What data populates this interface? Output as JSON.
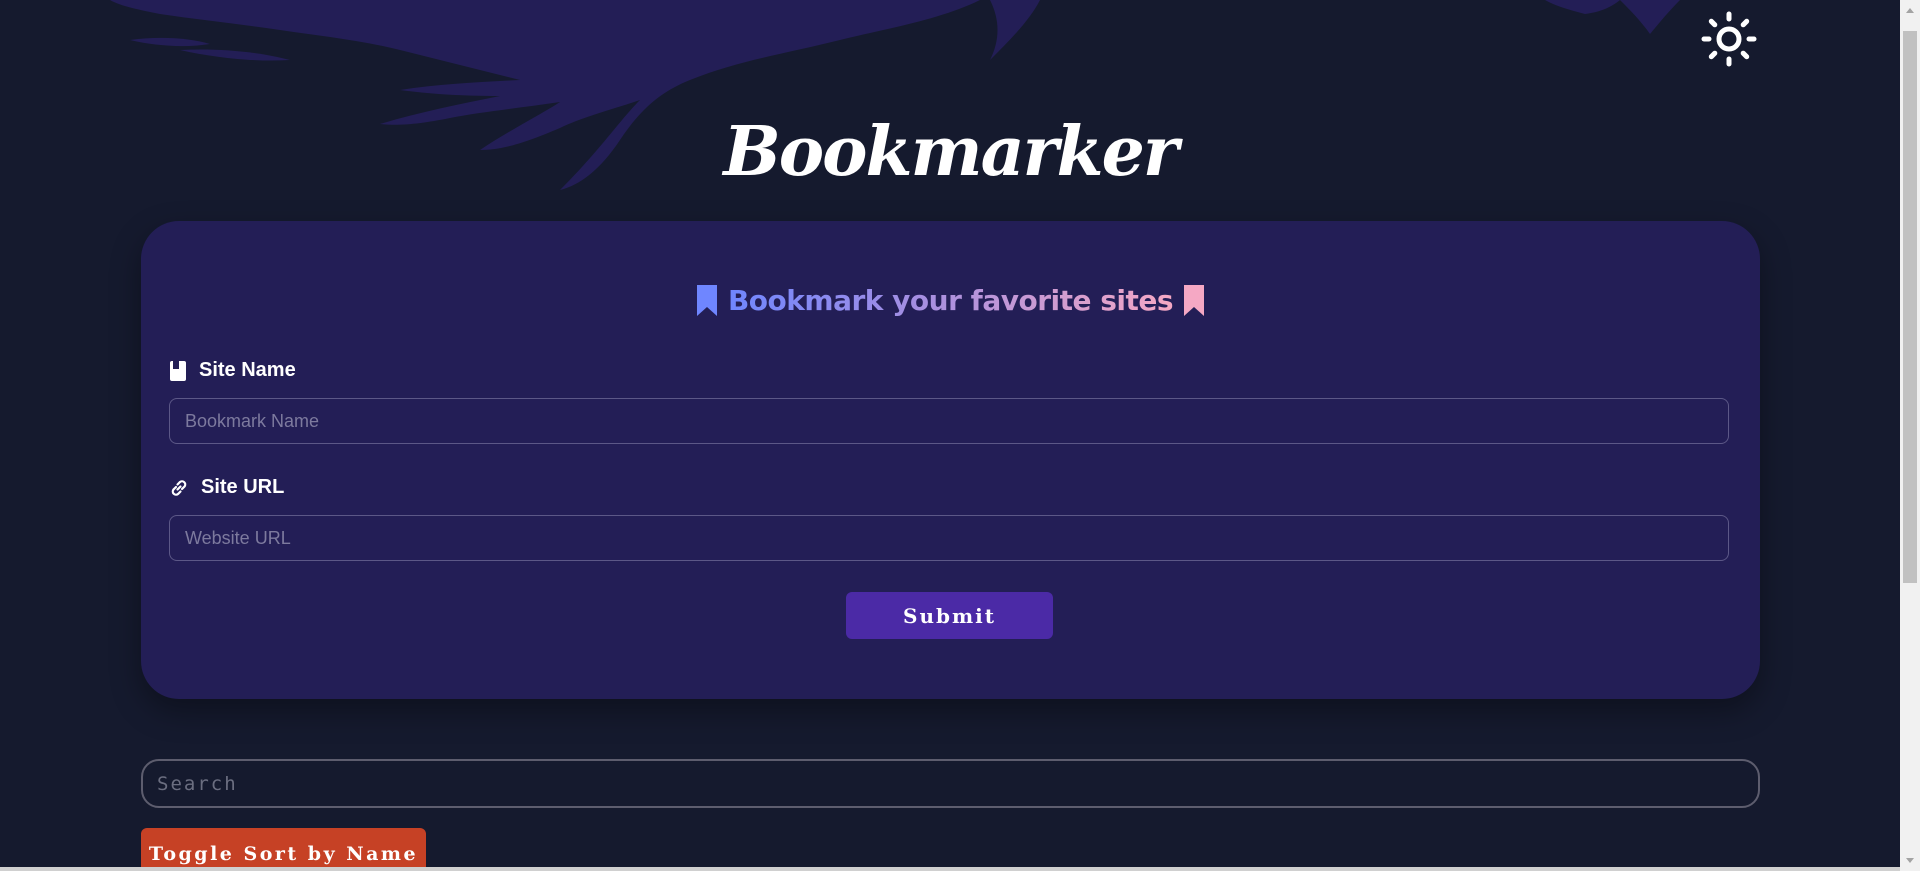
{
  "app": {
    "title": "Bookmarker"
  },
  "card": {
    "heading": "Bookmark your favorite sites",
    "site_name": {
      "label": "Site Name",
      "placeholder": "Bookmark Name",
      "value": ""
    },
    "site_url": {
      "label": "Site URL",
      "placeholder": "Website URL",
      "value": ""
    },
    "submit_label": "Submit"
  },
  "search": {
    "placeholder": "Search",
    "value": ""
  },
  "sort_button_label": "Toggle Sort by Name",
  "colors": {
    "background": "#151a2e",
    "card": "#231e56",
    "accent": "#4b2aa6",
    "sort_button": "#c64125",
    "heading_gradient_start": "#6f86ff",
    "heading_gradient_end": "#f5a8c4"
  },
  "icons": {
    "theme_toggle": "sun-icon",
    "heading_left": "bookmark-icon",
    "heading_right": "bookmark-icon",
    "site_name": "book-icon",
    "site_url": "link-icon"
  }
}
